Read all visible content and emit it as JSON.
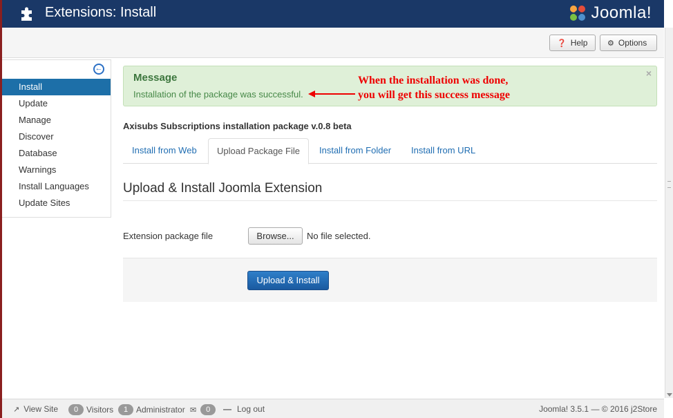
{
  "header": {
    "title": "Extensions: Install",
    "logo_text": "Joomla!"
  },
  "toolbar": {
    "help_label": "Help",
    "options_label": "Options"
  },
  "sidebar": {
    "items": [
      {
        "label": "Install",
        "active": true
      },
      {
        "label": "Update"
      },
      {
        "label": "Manage"
      },
      {
        "label": "Discover"
      },
      {
        "label": "Database"
      },
      {
        "label": "Warnings"
      },
      {
        "label": "Install Languages"
      },
      {
        "label": "Update Sites"
      }
    ]
  },
  "message": {
    "heading": "Message",
    "text": "Installation of the package was successful.",
    "close": "×"
  },
  "annotation": {
    "line1": "When the installation was done,",
    "line2": "you will get this success message"
  },
  "package_title": "Axisubs Subscriptions installation package v.0.8 beta",
  "tabs": [
    {
      "label": "Install from Web"
    },
    {
      "label": "Upload Package File",
      "active": true
    },
    {
      "label": "Install from Folder"
    },
    {
      "label": "Install from URL"
    }
  ],
  "section": {
    "title": "Upload & Install Joomla Extension",
    "field_label": "Extension package file",
    "browse_label": "Browse...",
    "file_status": "No file selected.",
    "submit_label": "Upload & Install"
  },
  "statusbar": {
    "view_site": "View Site",
    "visitors_count": "0",
    "visitors_label": "Visitors",
    "admin_count": "1",
    "admin_label": "Administrator",
    "messages_count": "0",
    "logout": "Log out",
    "version": "Joomla! 3.5.1  —  © 2016 j2Store"
  },
  "colors": {
    "header_bg": "#1a3867",
    "accent": "#1d6fa8",
    "success_bg": "#dff0d8",
    "annotation": "#ee0000"
  }
}
